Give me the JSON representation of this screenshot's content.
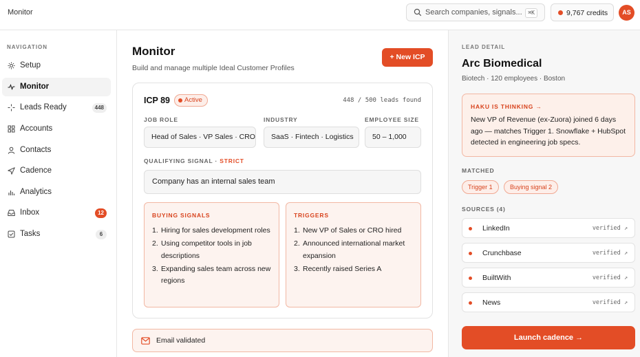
{
  "app": {
    "title": "Monitor"
  },
  "search": {
    "placeholder": "Search companies, signals...",
    "shortcut": "⌘K"
  },
  "credits": {
    "label": "9,767 credits"
  },
  "user": {
    "initials": "AS"
  },
  "sidebar": {
    "heading": "NAVIGATION",
    "items": [
      {
        "label": "Setup",
        "icon": "gear-icon"
      },
      {
        "label": "Monitor",
        "icon": "pulse-icon",
        "active": true
      },
      {
        "label": "Leads Ready",
        "icon": "target-icon",
        "badge": "448"
      },
      {
        "label": "Accounts",
        "icon": "grid-icon"
      },
      {
        "label": "Contacts",
        "icon": "user-icon"
      },
      {
        "label": "Cadence",
        "icon": "send-icon"
      },
      {
        "label": "Analytics",
        "icon": "bar-chart-icon"
      },
      {
        "label": "Inbox",
        "icon": "inbox-icon",
        "badge": "12"
      },
      {
        "label": "Tasks",
        "icon": "check-square-icon",
        "badge": "6"
      }
    ]
  },
  "main": {
    "title": "Monitor",
    "subtitle": "Build and manage multiple Ideal Customer Profiles",
    "new_button": "+ New ICP",
    "icp": {
      "name": "ICP 89",
      "status": "Active",
      "leads_found": "448 / 500 leads found",
      "fields": [
        {
          "label": "JOB ROLE",
          "value": "Head of Sales · VP Sales · CRO"
        },
        {
          "label": "INDUSTRY",
          "value": "SaaS · Fintech · Logistics"
        },
        {
          "label": "EMPLOYEE SIZE",
          "value": "50 – 1,000"
        }
      ],
      "qualifying": {
        "label": "QUALIFYING SIGNAL · ",
        "mode": "STRICT",
        "value": "Company has an internal sales team"
      },
      "buying_signals": {
        "title": "BUYING SIGNALS",
        "items": [
          "Hiring for sales development roles",
          "Using competitor tools in job descriptions",
          "Expanding sales team across new regions"
        ]
      },
      "triggers": {
        "title": "TRIGGERS",
        "items": [
          "New VP of Sales or CRO hired",
          "Announced international market expansion",
          "Recently raised Series A"
        ]
      }
    },
    "email_status": "Email validated"
  },
  "detail": {
    "heading": "LEAD DETAIL",
    "company": "Arc Biomedical",
    "meta": "Biotech · 120 employees · Boston",
    "thinking": {
      "title": "HAKU IS THINKING →",
      "text": "New VP of Revenue (ex-Zuora) joined 6 days ago — matches Trigger 1. Snowflake + HubSpot detected in engineering job specs."
    },
    "matched_heading": "MATCHED",
    "matched": [
      "Trigger 1",
      "Buying signal 2"
    ],
    "sources_heading": "SOURCES (4)",
    "sources": [
      {
        "name": "LinkedIn",
        "status": "verified ↗"
      },
      {
        "name": "Crunchbase",
        "status": "verified ↗"
      },
      {
        "name": "BuiltWith",
        "status": "verified ↗"
      },
      {
        "name": "News",
        "status": "verified ↗"
      }
    ],
    "launch_button": "Launch cadence →"
  },
  "colors": {
    "accent": "#e34d26",
    "accent_soft": "#fdf3ef",
    "border": "#e2e2e2"
  }
}
